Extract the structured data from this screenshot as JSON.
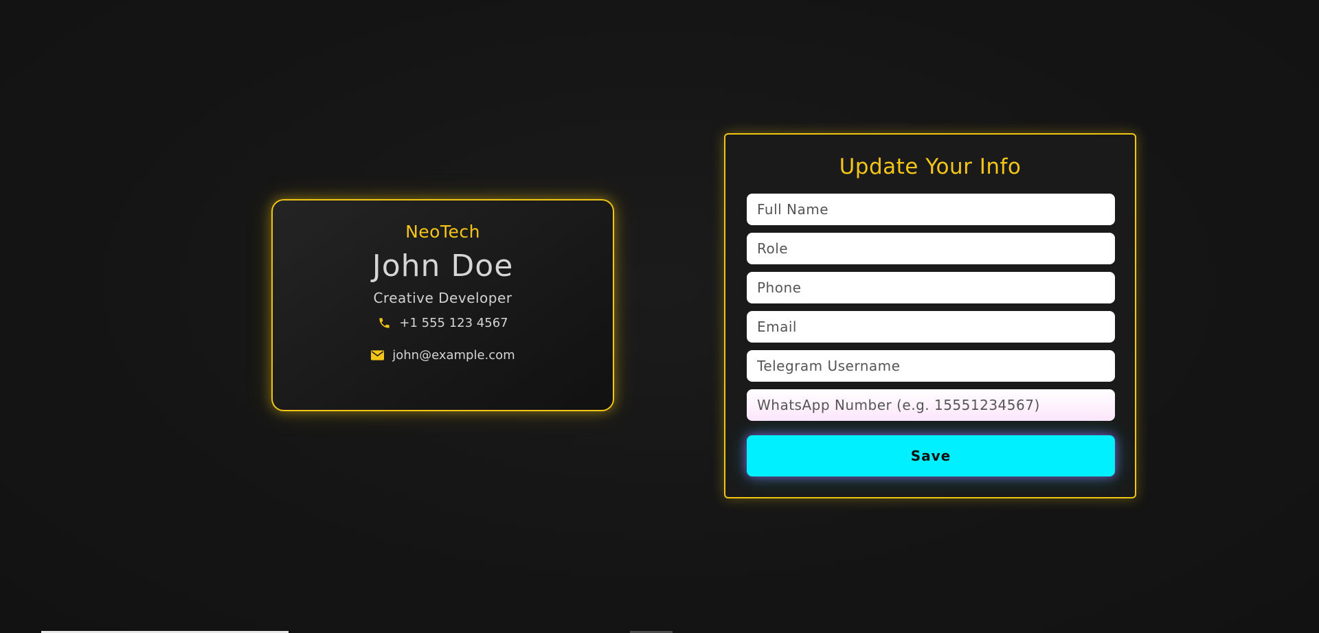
{
  "card": {
    "brand": "NeoTech",
    "name": "John Doe",
    "role": "Creative Developer",
    "phone": "+1 555 123 4567",
    "email": "john@example.com",
    "phone_icon": "phone-icon",
    "email_icon": "envelope-icon"
  },
  "form": {
    "title": "Update Your Info",
    "fields": {
      "full_name": {
        "placeholder": "Full Name",
        "value": ""
      },
      "role": {
        "placeholder": "Role",
        "value": ""
      },
      "phone": {
        "placeholder": "Phone",
        "value": ""
      },
      "email": {
        "placeholder": "Email",
        "value": ""
      },
      "telegram": {
        "placeholder": "Telegram Username",
        "value": ""
      },
      "whatsapp": {
        "placeholder": "WhatsApp Number (e.g. 15551234567)",
        "value": ""
      }
    },
    "save_label": "Save"
  },
  "colors": {
    "accent": "#f5c518",
    "button": "#00f0ff",
    "background": "#151515"
  }
}
